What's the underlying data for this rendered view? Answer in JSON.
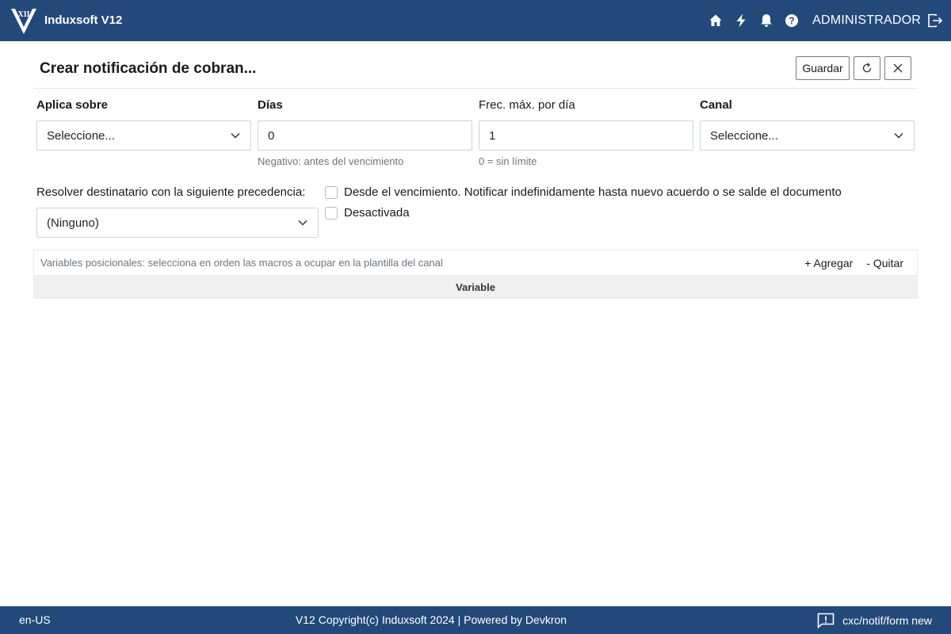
{
  "header": {
    "app_title": "Induxsoft V12",
    "logo_text": "XII",
    "icons": [
      "home-icon",
      "bolt-icon",
      "bell-icon",
      "help-icon",
      "logout-icon"
    ],
    "user": "ADMINISTRADOR",
    "color": "#23497a"
  },
  "page": {
    "title": "Crear notificación de cobran...",
    "save_label": "Guardar"
  },
  "form": {
    "aplica_sobre": {
      "label": "Aplica sobre",
      "value": "Seleccione..."
    },
    "dias": {
      "label": "Días",
      "value": "0",
      "hint": "Negativo: antes del vencimiento"
    },
    "frec_max": {
      "label": "Frec. máx. por día",
      "value": "1",
      "hint": "0 = sin límite"
    },
    "canal": {
      "label": "Canal",
      "value": "Seleccione..."
    },
    "resolver": {
      "label": "Resolver destinatario con la siguiente precedencia:",
      "value": "(Ninguno)"
    },
    "desde_vencimiento": {
      "label": "Desde el vencimiento. Notificar indefinidamente hasta nuevo acuerdo o se salde el documento"
    },
    "desactivada": {
      "label": "Desactivada"
    }
  },
  "variables": {
    "description": "Variables posicionales: selecciona en orden las macros a ocupar en la plantilla del canal",
    "add_label": "+ Agregar",
    "remove_label": "- Quitar",
    "column_header": "Variable"
  },
  "footer": {
    "locale": "en-US",
    "copyright": "V12 Copyright(c) Induxsoft 2024 | Powered by Devkron",
    "route": "cxc/notif/form new"
  }
}
